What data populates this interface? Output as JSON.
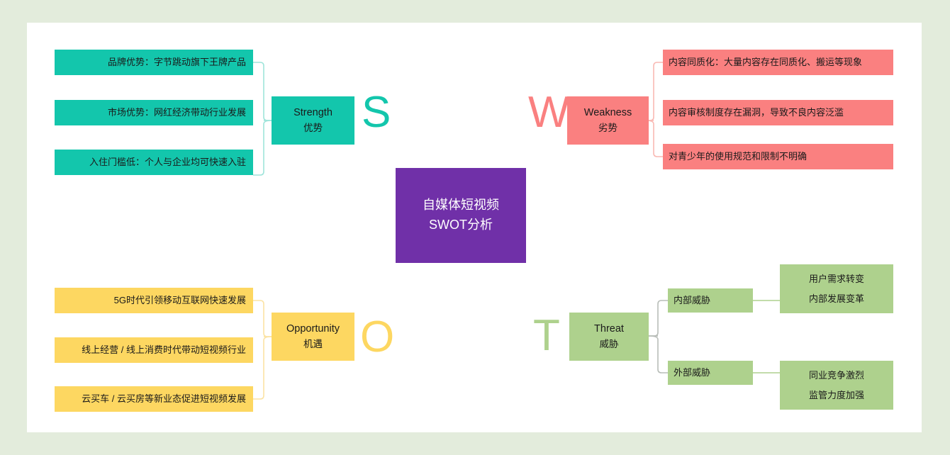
{
  "theme": {
    "page_background": "#e3ecdc",
    "card_background": "#ffffff",
    "strength_color": "#13c6ac",
    "weakness_color": "#fa8080",
    "opportunity_color": "#fdd761",
    "threat_color": "#aed18d",
    "center_color": "#7030a8",
    "text_color": "#1a1a1a",
    "connector_gray": "#b8bdb8"
  },
  "center": {
    "line1": "自媒体短视频",
    "line2": "SWOT分析"
  },
  "quadrants": {
    "strength": {
      "letter": "S",
      "label_en": "Strength",
      "label_cn": "优势",
      "items": [
        "品牌优势：字节跳动旗下王牌产品",
        "市场优势：网红经济带动行业发展",
        "入住门槛低：个人与企业均可快速入驻"
      ]
    },
    "weakness": {
      "letter": "W",
      "label_en": "Weakness",
      "label_cn": "劣势",
      "items": [
        "内容同质化：大量内容存在同质化、搬运等现象",
        "内容审核制度存在漏洞，导致不良内容泛滥",
        "对青少年的使用规范和限制不明确"
      ]
    },
    "opportunity": {
      "letter": "O",
      "label_en": "Opportunity",
      "label_cn": "机遇",
      "items": [
        "5G时代引领移动互联网快速发展",
        "线上经营 / 线上消费时代带动短视频行业",
        "云买车 / 云买房等新业态促进短视频发展"
      ]
    },
    "threat": {
      "letter": "T",
      "label_en": "Threat",
      "label_cn": "威胁",
      "branches": [
        {
          "title": "内部威胁",
          "details": [
            "用户需求转变",
            "内部发展变革"
          ]
        },
        {
          "title": "外部威胁",
          "details": [
            "同业竞争激烈",
            "监管力度加强"
          ]
        }
      ]
    }
  }
}
